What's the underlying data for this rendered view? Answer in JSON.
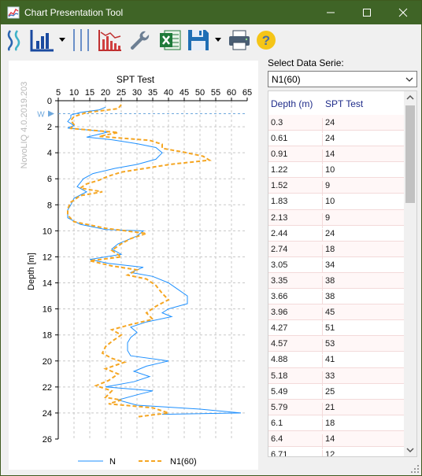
{
  "window": {
    "title": "Chart Presentation Tool",
    "accent": "#3f6426"
  },
  "toolbar": {
    "icons": [
      "liquefaction-icon",
      "bar-chart-icon",
      "dropdown-arrow-icon",
      "vertical-lines-icon",
      "cyclic-chart-icon",
      "settings-wrench-icon",
      "excel-icon",
      "save-icon",
      "dropdown-arrow-icon",
      "print-icon",
      "help-icon"
    ]
  },
  "selector": {
    "label": "Select Data Serie:",
    "value": "N1(60)"
  },
  "table": {
    "headers": [
      "Depth (m)",
      "SPT Test"
    ],
    "rows": [
      [
        "0.3",
        "24"
      ],
      [
        "0.61",
        "24"
      ],
      [
        "0.91",
        "14"
      ],
      [
        "1.22",
        "10"
      ],
      [
        "1.52",
        "9"
      ],
      [
        "1.83",
        "10"
      ],
      [
        "2.13",
        "9"
      ],
      [
        "2.44",
        "24"
      ],
      [
        "2.74",
        "18"
      ],
      [
        "3.05",
        "34"
      ],
      [
        "3.35",
        "38"
      ],
      [
        "3.66",
        "38"
      ],
      [
        "3.96",
        "45"
      ],
      [
        "4.27",
        "51"
      ],
      [
        "4.57",
        "53"
      ],
      [
        "4.88",
        "41"
      ],
      [
        "5.18",
        "33"
      ],
      [
        "5.49",
        "25"
      ],
      [
        "5.79",
        "21"
      ],
      [
        "6.1",
        "18"
      ],
      [
        "6.4",
        "14"
      ],
      [
        "6.71",
        "12"
      ]
    ]
  },
  "chart_data": {
    "type": "line",
    "title": "SPT Test",
    "xlabel": "",
    "ylabel": "Depth [m]",
    "watermark": "NovoLIQ 4.0.2019.203",
    "water_marker": "W",
    "xlim": [
      5,
      65
    ],
    "ylim": [
      0,
      26
    ],
    "y_inverted": true,
    "x_ticks": [
      5,
      10,
      15,
      20,
      25,
      30,
      35,
      40,
      45,
      50,
      55,
      60,
      65
    ],
    "y_ticks": [
      0,
      2,
      4,
      6,
      8,
      10,
      12,
      14,
      16,
      18,
      20,
      22,
      24,
      26
    ],
    "grid": true,
    "legend": "bottom",
    "water_level": 1.0,
    "series": [
      {
        "name": "N",
        "color": "#1e90ff",
        "style": "solid",
        "points": [
          [
            20,
            0.5
          ],
          [
            18,
            0.7
          ],
          [
            12,
            0.9
          ],
          [
            9,
            1.1
          ],
          [
            9,
            1.3
          ],
          [
            8,
            1.6
          ],
          [
            10,
            1.9
          ],
          [
            8,
            2.1
          ],
          [
            21,
            2.4
          ],
          [
            14,
            2.8
          ],
          [
            22,
            3.0
          ],
          [
            30,
            3.3
          ],
          [
            36,
            3.6
          ],
          [
            38,
            4.0
          ],
          [
            36,
            4.5
          ],
          [
            30,
            4.9
          ],
          [
            23,
            5.2
          ],
          [
            16,
            5.6
          ],
          [
            13,
            6.0
          ],
          [
            11,
            6.6
          ],
          [
            14,
            7.0
          ],
          [
            10,
            7.5
          ],
          [
            9,
            8.0
          ],
          [
            8,
            8.4
          ],
          [
            8,
            9.0
          ],
          [
            12,
            9.5
          ],
          [
            20,
            9.9
          ],
          [
            32,
            10.0
          ],
          [
            30,
            10.4
          ],
          [
            24,
            11.0
          ],
          [
            22,
            11.4
          ],
          [
            25,
            11.8
          ],
          [
            15,
            12.2
          ],
          [
            21,
            12.5
          ],
          [
            32,
            12.8
          ],
          [
            28,
            13.2
          ],
          [
            35,
            13.5
          ],
          [
            40,
            14.0
          ],
          [
            43,
            14.5
          ],
          [
            46,
            15.0
          ],
          [
            46,
            15.6
          ],
          [
            40,
            16.0
          ],
          [
            38,
            16.3
          ],
          [
            41,
            16.6
          ],
          [
            33,
            17.0
          ],
          [
            28,
            17.4
          ],
          [
            30,
            17.8
          ],
          [
            28,
            18.2
          ],
          [
            27,
            18.6
          ],
          [
            27,
            19.2
          ],
          [
            28,
            19.6
          ],
          [
            40,
            20.0
          ],
          [
            33,
            20.4
          ],
          [
            29,
            20.8
          ],
          [
            34,
            21.2
          ],
          [
            29,
            21.6
          ],
          [
            20,
            22.0
          ],
          [
            35,
            22.3
          ],
          [
            30,
            22.6
          ],
          [
            24,
            23.0
          ],
          [
            30,
            23.4
          ],
          [
            50,
            23.7
          ],
          [
            63,
            24.0
          ],
          [
            38,
            24.1
          ]
        ]
      },
      {
        "name": "N1(60)",
        "color": "#f5a623",
        "style": "dashed",
        "points": [
          [
            25,
            0.3
          ],
          [
            24,
            0.61
          ],
          [
            14,
            0.91
          ],
          [
            10,
            1.22
          ],
          [
            9,
            1.52
          ],
          [
            10,
            1.83
          ],
          [
            9,
            2.13
          ],
          [
            24,
            2.44
          ],
          [
            18,
            2.74
          ],
          [
            34,
            3.05
          ],
          [
            38,
            3.35
          ],
          [
            38,
            3.66
          ],
          [
            45,
            3.96
          ],
          [
            51,
            4.27
          ],
          [
            53,
            4.57
          ],
          [
            41,
            4.88
          ],
          [
            33,
            5.18
          ],
          [
            25,
            5.49
          ],
          [
            21,
            5.79
          ],
          [
            18,
            6.1
          ],
          [
            14,
            6.4
          ],
          [
            12,
            6.71
          ],
          [
            19,
            7.0
          ],
          [
            12,
            7.3
          ],
          [
            9,
            7.8
          ],
          [
            8,
            8.3
          ],
          [
            8,
            8.8
          ],
          [
            10,
            9.3
          ],
          [
            20,
            9.8
          ],
          [
            33,
            10.2
          ],
          [
            28,
            10.6
          ],
          [
            25,
            11.0
          ],
          [
            22,
            11.5
          ],
          [
            25,
            12.0
          ],
          [
            15,
            12.3
          ],
          [
            22,
            12.7
          ],
          [
            30,
            13.0
          ],
          [
            27,
            13.4
          ],
          [
            33,
            13.7
          ],
          [
            36,
            14.2
          ],
          [
            38,
            14.8
          ],
          [
            40,
            15.3
          ],
          [
            36,
            15.8
          ],
          [
            33,
            16.3
          ],
          [
            35,
            16.8
          ],
          [
            28,
            17.2
          ],
          [
            22,
            17.6
          ],
          [
            25,
            18.0
          ],
          [
            22,
            18.5
          ],
          [
            20,
            18.9
          ],
          [
            19,
            19.4
          ],
          [
            22,
            19.8
          ],
          [
            26,
            20.1
          ],
          [
            20,
            20.6
          ],
          [
            24,
            21.0
          ],
          [
            21,
            21.5
          ],
          [
            17,
            21.9
          ],
          [
            22,
            22.3
          ],
          [
            20,
            22.8
          ],
          [
            25,
            23.0
          ],
          [
            21,
            23.3
          ],
          [
            35,
            23.6
          ],
          [
            40,
            24.0
          ],
          [
            30,
            24.3
          ]
        ]
      }
    ]
  }
}
